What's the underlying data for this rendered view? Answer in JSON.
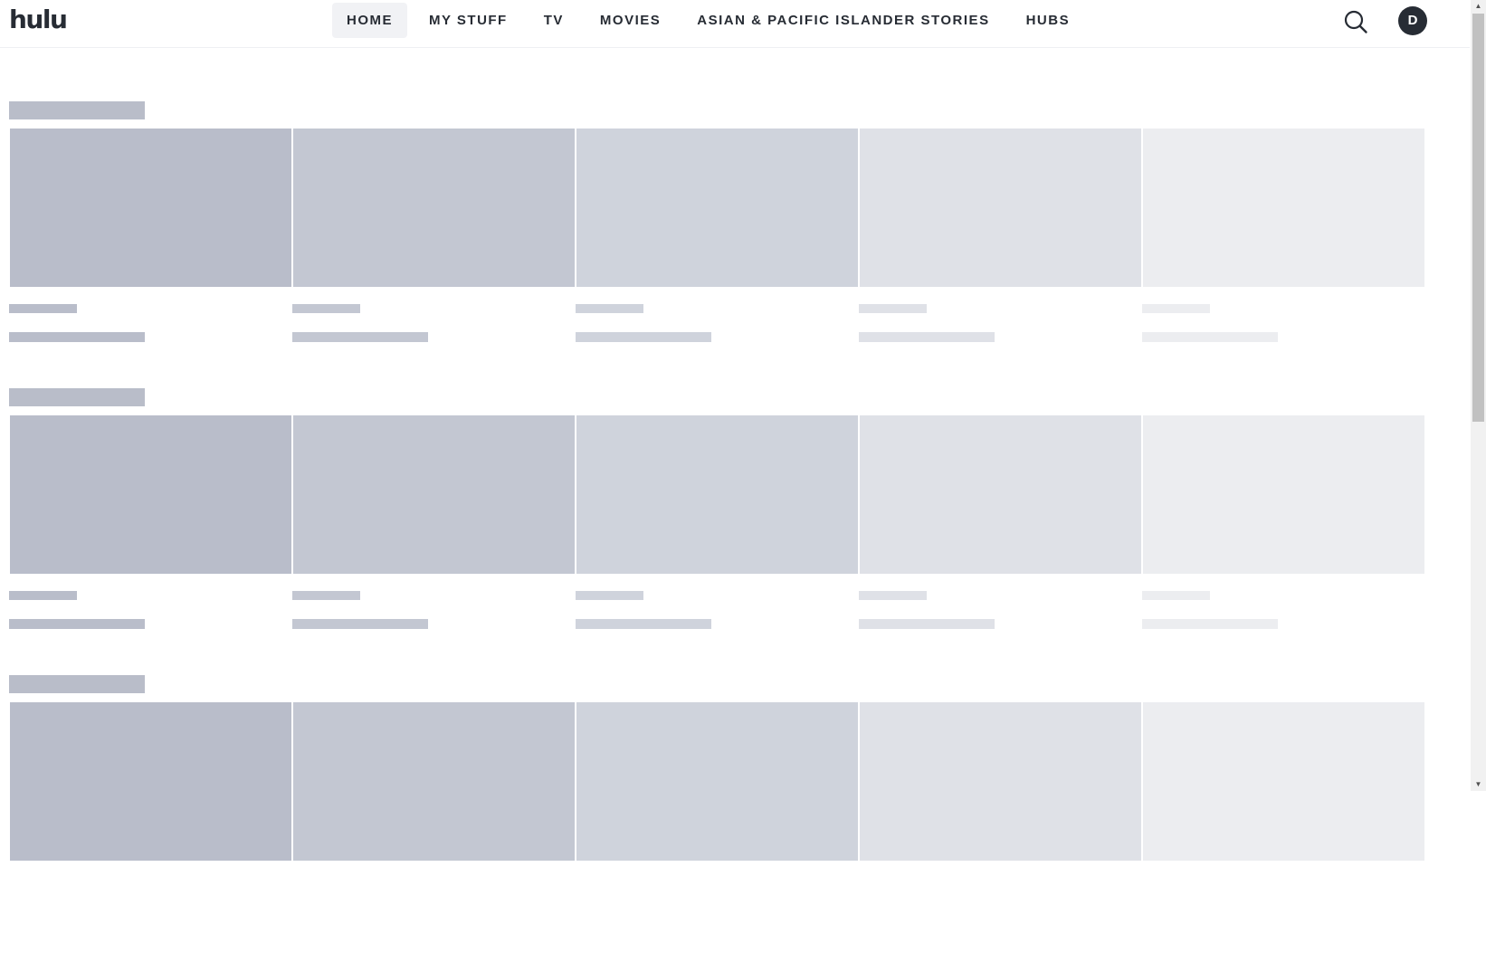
{
  "brand": {
    "logo_text": "hulu"
  },
  "nav": {
    "items": [
      {
        "label": "HOME",
        "active": true
      },
      {
        "label": "MY STUFF",
        "active": false
      },
      {
        "label": "TV",
        "active": false
      },
      {
        "label": "MOVIES",
        "active": false
      },
      {
        "label": "ASIAN & PACIFIC ISLANDER STORIES",
        "active": false
      },
      {
        "label": "HUBS",
        "active": false
      }
    ]
  },
  "header": {
    "search_icon": "search-icon",
    "avatar_initial": "D"
  },
  "colors": {
    "text_primary": "#272c34",
    "active_tab_bg": "#f1f2f5",
    "skeleton_shades": [
      "#b9bdca",
      "#c3c7d2",
      "#cfd3dc",
      "#dfe1e7",
      "#ecedf0"
    ]
  }
}
